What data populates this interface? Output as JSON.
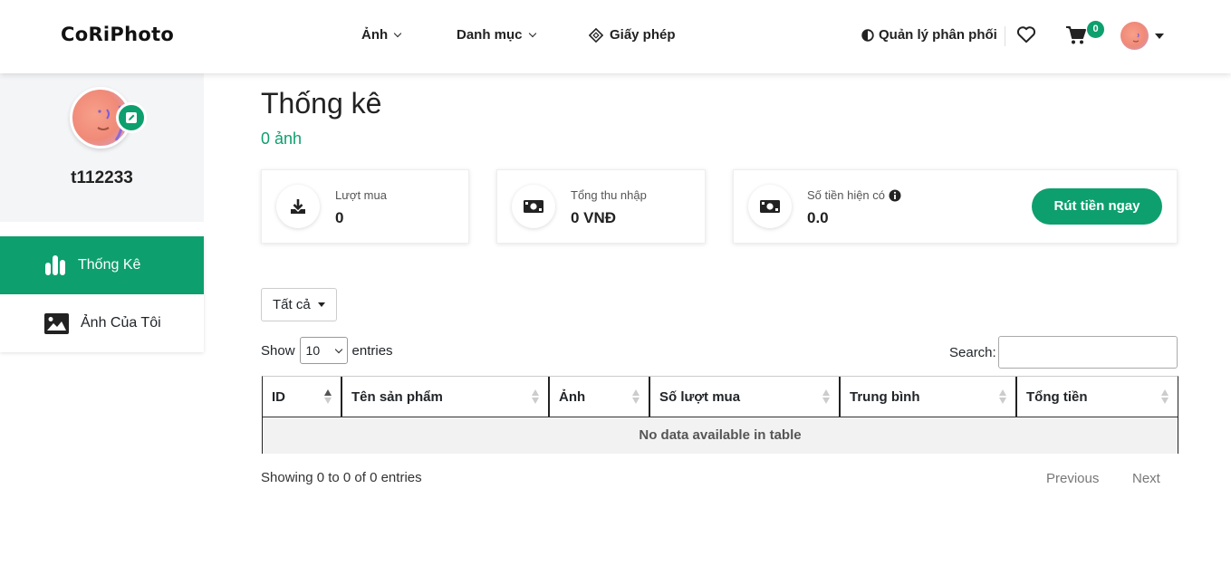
{
  "header": {
    "logo": "CoRiPhoto",
    "nav": [
      {
        "label": "Ảnh",
        "dropdown": true
      },
      {
        "label": "Danh mục",
        "dropdown": true
      },
      {
        "label": "Giấy phép",
        "icon": "diamond-icon"
      }
    ],
    "distribution_label": "Quản lý phân phối",
    "cart_count": "0",
    "icons": [
      "half-circle-icon",
      "heart-icon",
      "cart-icon",
      "caret-down-icon"
    ]
  },
  "sidebar": {
    "username": "t112233",
    "items": [
      {
        "label": "Thống Kê",
        "icon": "bar-chart-icon",
        "active": true
      },
      {
        "label": "Ảnh Của Tôi",
        "icon": "image-icon",
        "active": false
      }
    ]
  },
  "main": {
    "title": "Thống kê",
    "subtitle": "0 ảnh",
    "cards": [
      {
        "label": "Lượt mua",
        "value": "0",
        "icon": "download-icon"
      },
      {
        "label": "Tổng thu nhập",
        "value": "0 VNĐ",
        "icon": "money-icon"
      },
      {
        "label": "Số tiền hiện có",
        "value": "0.0",
        "icon": "money-icon",
        "button": "Rút tiền ngay"
      }
    ],
    "filter": "Tất cả",
    "show_label": "Show",
    "page_size": "10",
    "entries_label": "entries",
    "search_label": "Search:",
    "columns": [
      "ID",
      "Tên sản phẩm",
      "Ảnh",
      "Số lượt mua",
      "Trung bình",
      "Tổng tiền"
    ],
    "empty_message": "No data available in table",
    "info": "Showing 0 to 0 of 0 entries",
    "previous": "Previous",
    "next": "Next"
  },
  "colors": {
    "accent": "#0e9f6e"
  }
}
